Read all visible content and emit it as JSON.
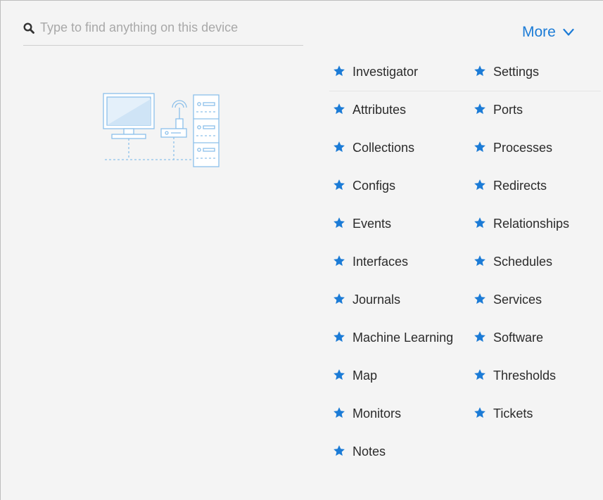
{
  "search": {
    "placeholder": "Type to find anything on this device",
    "icon": "search-icon"
  },
  "more": {
    "label": "More",
    "icon": "chevron-down-icon",
    "color": "#1b7bd6"
  },
  "accent_color": "#1b7bd6",
  "left_items": [
    "Investigator",
    "Attributes",
    "Collections",
    "Configs",
    "Events",
    "Interfaces",
    "Journals",
    "Machine Learning",
    "Map",
    "Monitors",
    "Notes"
  ],
  "right_items": [
    "Settings",
    "Ports",
    "Processes",
    "Redirects",
    "Relationships",
    "Schedules",
    "Services",
    "Software",
    "Thresholds",
    "Tickets"
  ]
}
